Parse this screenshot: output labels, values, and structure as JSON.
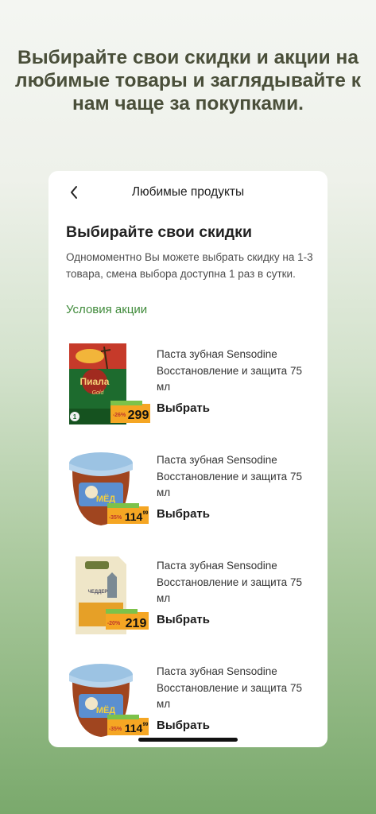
{
  "promo": {
    "headline": "Выбирайте свои скидки и акции на любимые товары и заглядывайте к нам чаще за покупками."
  },
  "screen": {
    "title": "Любимые продукты",
    "section_title": "Выбирайте свои скидки",
    "description": "Одномоментно Вы можете выбрать скидку на 1-3 товара, смена выбора доступна 1 раз в сутки.",
    "terms_link": "Условия акции"
  },
  "products": [
    {
      "name": "Паста зубная Sensodine Восстановление и защита 75 мл",
      "action": "Выбрать",
      "price": "299",
      "discount": "-26%",
      "image": "tea-box-image",
      "brand": "Пиала",
      "brand_sub": "Gold"
    },
    {
      "name": "Паста зубная Sensodine Восстановление и защита 75 мл",
      "action": "Выбрать",
      "price": "114",
      "price_cents": "99",
      "discount": "-35%",
      "image": "honey-jar-image",
      "brand": "МЁД"
    },
    {
      "name": "Паста зубная Sensodine Восстановление и защита 75 мл",
      "action": "Выбрать",
      "price": "219",
      "discount": "-20%",
      "image": "cheese-pack-image",
      "brand": "ЧЕДДЕР"
    },
    {
      "name": "Паста зубная Sensodine Восстановление и защита 75 мл",
      "action": "Выбрать",
      "price": "114",
      "price_cents": "99",
      "discount": "-35%",
      "image": "honey-jar-image",
      "brand": "МЁД"
    }
  ],
  "colors": {
    "accent_green": "#3f8a3a",
    "price_tag": "#f5a623",
    "headline": "#4a4f3a"
  }
}
